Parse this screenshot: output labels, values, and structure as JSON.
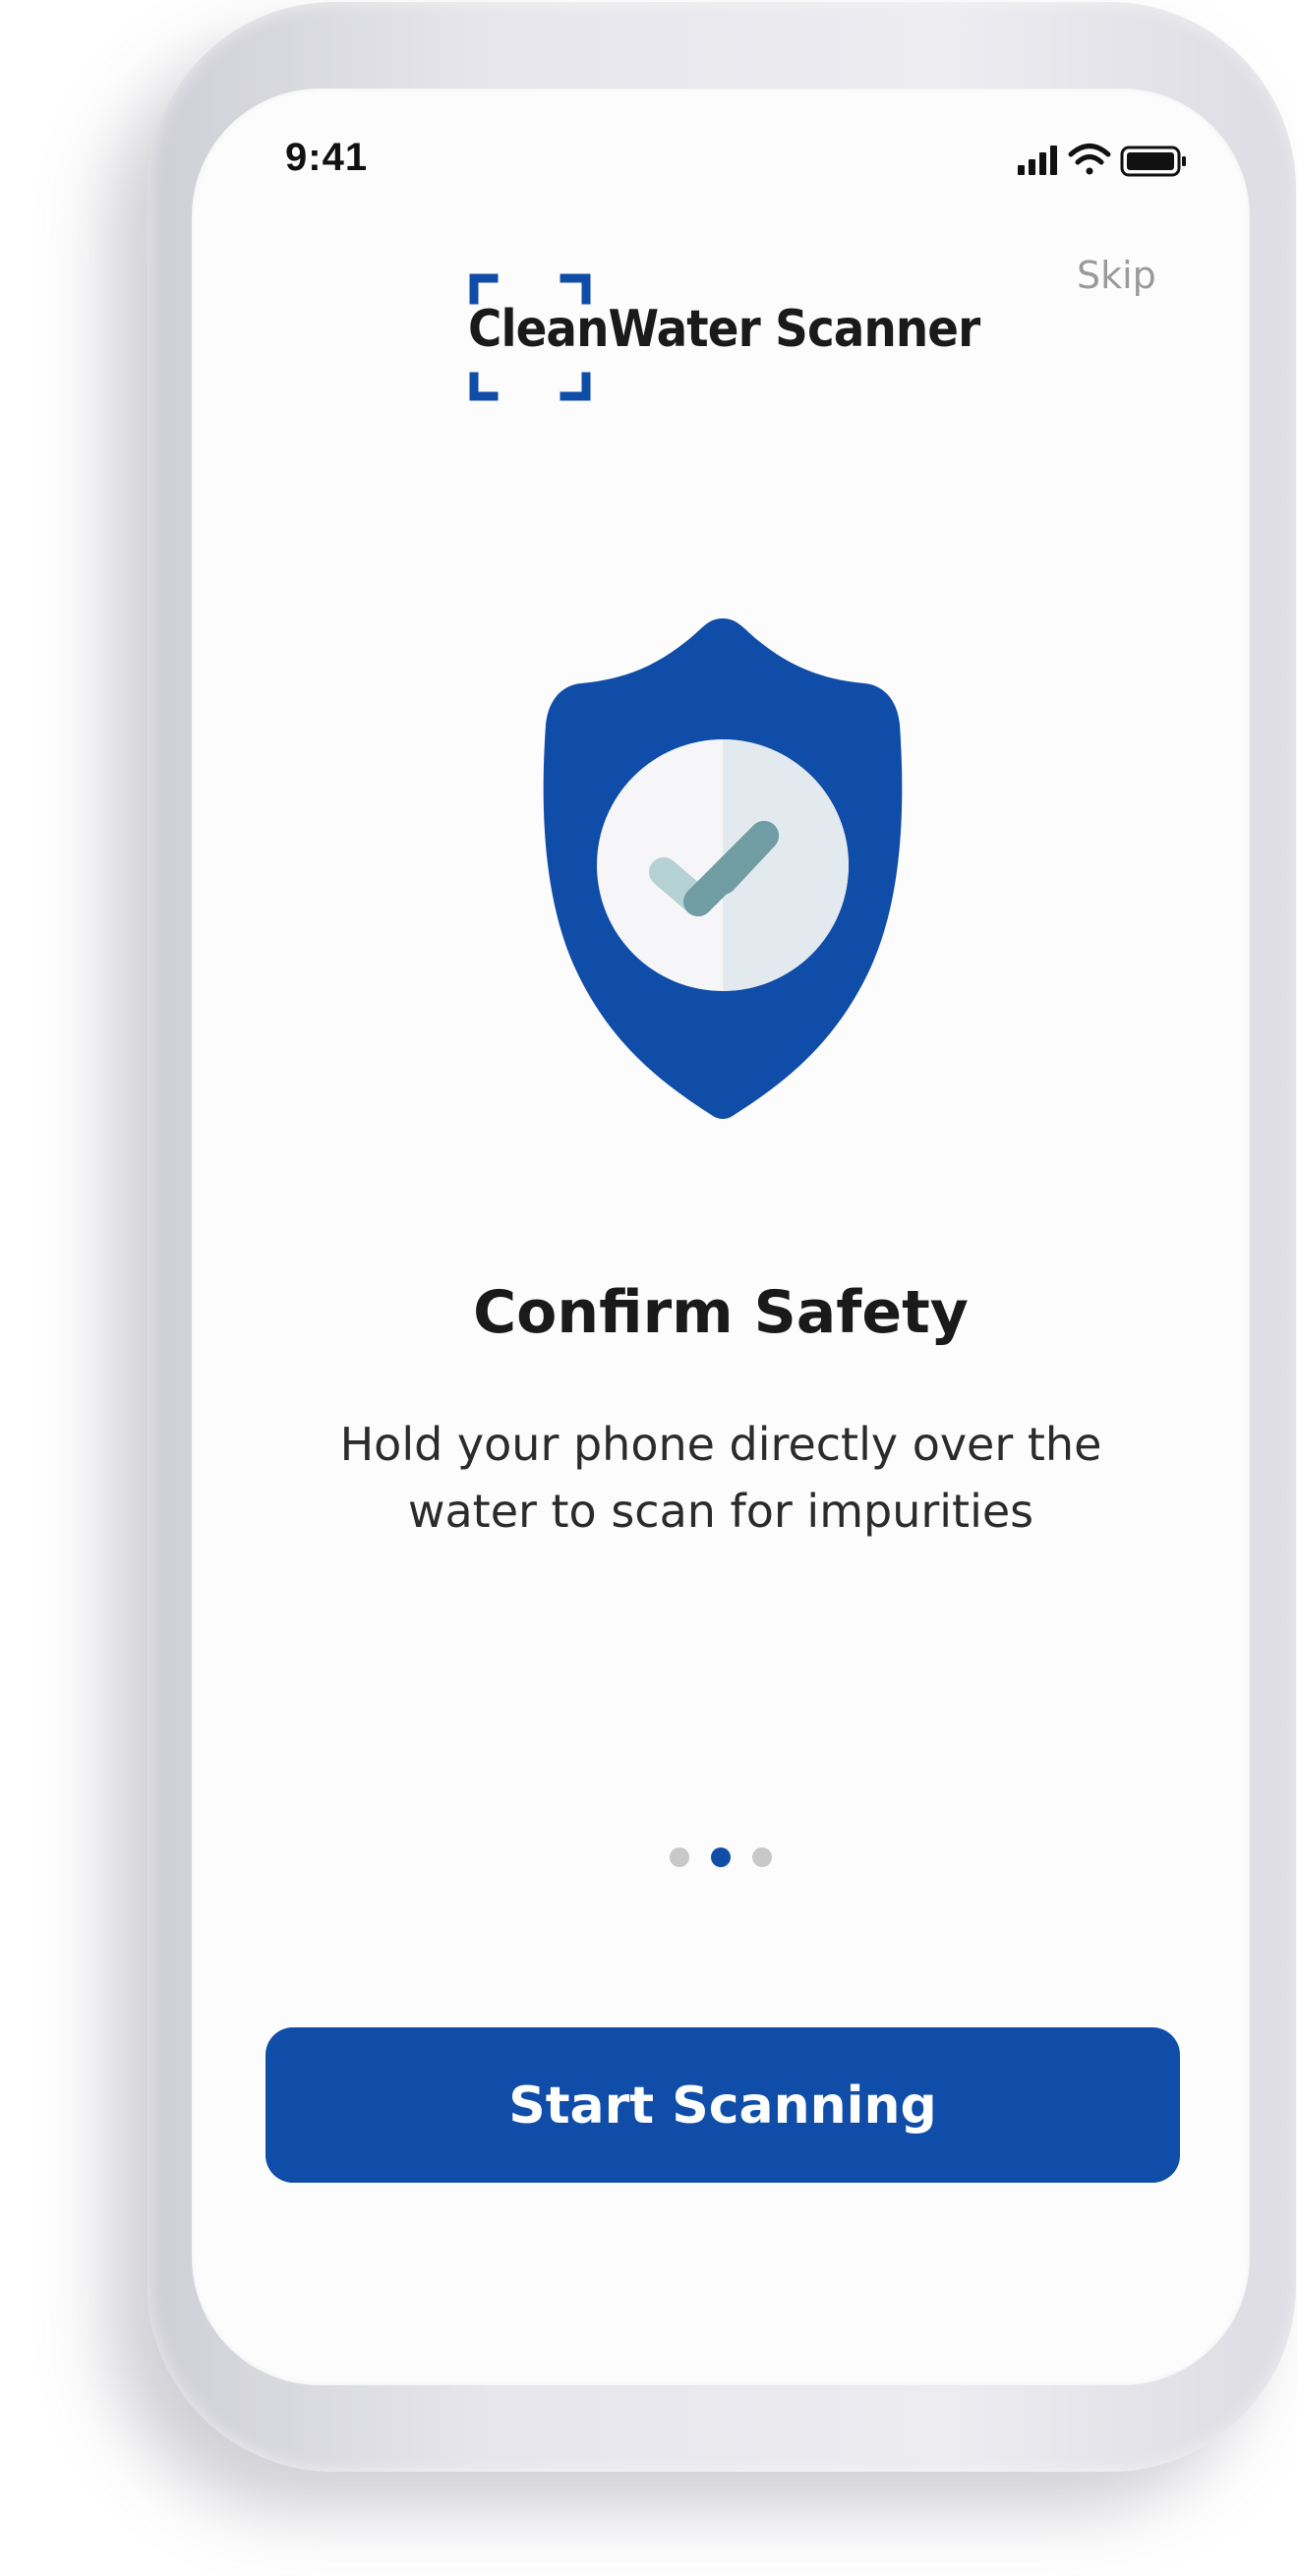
{
  "status_bar": {
    "time": "9:41",
    "signal_icon": "cellular-signal-icon",
    "wifi_icon": "wifi-icon",
    "battery_icon": "battery-icon"
  },
  "header": {
    "skip_label": "Skip",
    "logo_text": "CleanWater Scanner",
    "logo_icon": "scan-frame-icon"
  },
  "hero": {
    "icon": "shield-check-icon"
  },
  "content": {
    "title": "Confirm Safety",
    "subtitle": "Hold your phone directly over the water to scan for impurities"
  },
  "pagination": {
    "total": 3,
    "active_index": 1
  },
  "cta": {
    "label": "Start Scanning"
  },
  "colors": {
    "primary": "#0f4da8",
    "text": "#1a1a1a",
    "muted": "#9a9a9a",
    "dot_inactive": "#c8c8c8",
    "check": "#7aa6ab",
    "circle_light": "#f6f6f8",
    "circle_shade": "#e2e9ef"
  }
}
